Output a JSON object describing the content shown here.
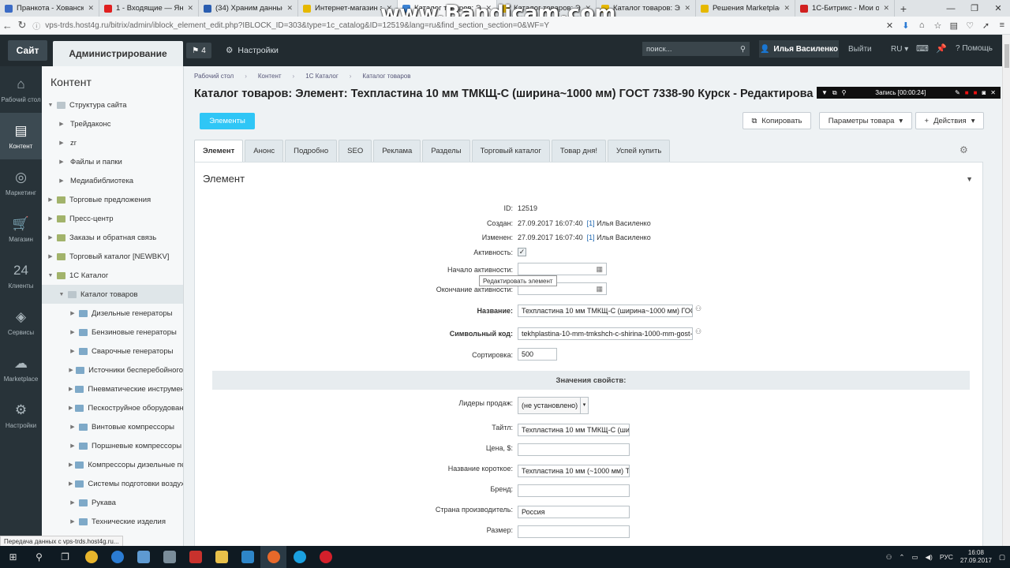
{
  "browser": {
    "tabs": [
      {
        "title": "Пранкота - Хованск",
        "color": "#3b6bc5",
        "active": false
      },
      {
        "title": "1 - Входящие — Яндекс",
        "color": "#e02020",
        "active": false
      },
      {
        "title": "(34) Храним данные в",
        "color": "#2a5db0",
        "active": false
      },
      {
        "title": "Интернет-магазин э",
        "color": "#e6b800",
        "active": false
      },
      {
        "title": "Каталог товаров: Элем",
        "color": "#3c83d4",
        "active": true
      },
      {
        "title": "Каталог товаров: Элем",
        "color": "#e6b800",
        "active": false
      },
      {
        "title": "Каталог товаров: Элем",
        "color": "#e6b800",
        "active": false
      },
      {
        "title": "Решения Marketplace",
        "color": "#e6b800",
        "active": false
      },
      {
        "title": "1С-Битрикс - Мои обр",
        "color": "#d12020",
        "active": false
      }
    ],
    "url": "vps-trds.host4g.ru/bitrix/admin/iblock_element_edit.php?IBLOCK_ID=303&type=1c_catalog&ID=12519&lang=ru&find_section_section=0&WF=Y",
    "url_info": "ⓘ"
  },
  "watermark": "www.Bandicam.com",
  "recorder": {
    "label": "Запись [00:00:24]"
  },
  "panel": {
    "site_label": "Сайт",
    "admin_label": "Администрирование",
    "notif_count": "4",
    "settings_label": "Настройки",
    "search_placeholder": "поиск...",
    "user_name": "Илья Василенко",
    "logout_label": "Выйти",
    "lang_label": "RU",
    "help_label": "Помощь"
  },
  "sidebar_icons": [
    {
      "label": "Рабочий стол",
      "icon": "home-icon",
      "active": false
    },
    {
      "label": "Контент",
      "icon": "document-icon",
      "active": true
    },
    {
      "label": "Маркетинг",
      "icon": "target-icon",
      "active": false
    },
    {
      "label": "Магазин",
      "icon": "cart-icon",
      "active": false
    },
    {
      "label": "Клиенты",
      "icon": "clients-icon",
      "active": false
    },
    {
      "label": "Сервисы",
      "icon": "layers-icon",
      "active": false
    },
    {
      "label": "Marketplace",
      "icon": "cloud-download-icon",
      "active": false
    },
    {
      "label": "Настройки",
      "icon": "gear-icon",
      "active": false
    }
  ],
  "tree": {
    "title": "Контент",
    "items": [
      {
        "label": "Структура сайта",
        "level": 1,
        "folder": "grey",
        "arrow": "▼"
      },
      {
        "label": "Трейдаконс",
        "level": 2,
        "folder": "none",
        "arrow": "▶"
      },
      {
        "label": "zr",
        "level": 2,
        "folder": "none",
        "arrow": "▶"
      },
      {
        "label": "Файлы и папки",
        "level": 2,
        "folder": "none",
        "arrow": "▶"
      },
      {
        "label": "Медиабиблиотека",
        "level": 2,
        "folder": "none",
        "arrow": "▶"
      },
      {
        "label": "Торговые предложения",
        "level": 1,
        "folder": "green",
        "arrow": "▶"
      },
      {
        "label": "Пресс-центр",
        "level": 1,
        "folder": "green",
        "arrow": "▶"
      },
      {
        "label": "Заказы и обратная связь",
        "level": 1,
        "folder": "green",
        "arrow": "▶"
      },
      {
        "label": "Торговый каталог [NEWBKV]",
        "level": 1,
        "folder": "green",
        "arrow": "▶"
      },
      {
        "label": "1С Каталог",
        "level": 1,
        "folder": "green",
        "arrow": "▼"
      },
      {
        "label": "Каталог товаров",
        "level": 2,
        "folder": "grey",
        "arrow": "▼",
        "active": true
      },
      {
        "label": "Дизельные генераторы",
        "level": 3,
        "folder": "blue",
        "arrow": "▶"
      },
      {
        "label": "Бензиновые генераторы",
        "level": 3,
        "folder": "blue",
        "arrow": "▶"
      },
      {
        "label": "Сварочные генераторы",
        "level": 3,
        "folder": "blue",
        "arrow": "▶"
      },
      {
        "label": "Источники бесперебойного",
        "level": 3,
        "folder": "blue",
        "arrow": "▶"
      },
      {
        "label": "Пневматические инструмен",
        "level": 3,
        "folder": "blue",
        "arrow": "▶"
      },
      {
        "label": "Пескоструйное оборудован",
        "level": 3,
        "folder": "blue",
        "arrow": "▶"
      },
      {
        "label": "Винтовые компрессоры",
        "level": 3,
        "folder": "blue",
        "arrow": "▶"
      },
      {
        "label": "Поршневые компрессоры",
        "level": 3,
        "folder": "blue",
        "arrow": "▶"
      },
      {
        "label": "Компрессоры дизельные пе",
        "level": 3,
        "folder": "blue",
        "arrow": "▶"
      },
      {
        "label": "Системы подготовки воздух",
        "level": 3,
        "folder": "blue",
        "arrow": "▶"
      },
      {
        "label": "Рукава",
        "level": 3,
        "folder": "blue",
        "arrow": "▶"
      },
      {
        "label": "Технические изделия",
        "level": 3,
        "folder": "blue",
        "arrow": "▶"
      }
    ]
  },
  "breadcrumbs": [
    "Рабочий стол",
    "Контент",
    "1С Каталог",
    "Каталог товаров"
  ],
  "page_title": "Каталог товаров: Элемент: Техпластина 10 мм ТМКЩ-С (ширина~1000 мм) ГОСТ 7338-90 Курск - Редактирова",
  "toolbar": {
    "elements_label": "Элементы",
    "copy_label": "Копировать",
    "params_label": "Параметры товара",
    "actions_label": "Действия"
  },
  "form_tabs": [
    "Элемент",
    "Анонс",
    "Подробно",
    "SEO",
    "Реклама",
    "Разделы",
    "Торговый каталог",
    "Товар дня!",
    "Успей купить"
  ],
  "section_title": "Элемент",
  "fields": {
    "id_label": "ID:",
    "id_value": "12519",
    "created_label": "Создан:",
    "created_value": "27.09.2017 16:07:40",
    "created_user_ref": "[1]",
    "created_user": "Илья Василенко",
    "modified_label": "Изменен:",
    "modified_value": "27.09.2017 16:07:40",
    "modified_user_ref": "[1]",
    "modified_user": "Илья Василенко",
    "active_label": "Активность:",
    "active_checked": "✓",
    "start_label": "Начало активности:",
    "end_label": "Окончание активности:",
    "name_label": "Название:",
    "name_value": "Техпластина 10 мм ТМКЩ-С (ширина~1000 мм) ГОСТ",
    "code_label": "Символьный код:",
    "code_value": "tekhplastina-10-mm-tmkshch-c-shirina-1000-mm-gost-7",
    "sort_label": "Сортировка:",
    "sort_value": "500"
  },
  "tooltip": "Редактировать элемент",
  "props": {
    "title": "Значения свойств:",
    "leaders_label": "Лидеры продаж:",
    "leaders_value": "(не установлено)",
    "title_label": "Тайтл:",
    "title_value": "Техпластина 10 мм ТМКЩ-С (шир",
    "price_label": "Цена, $:",
    "price_value": "",
    "short_label": "Название короткое:",
    "short_value": "Техпластина 10 мм (~1000 мм) ТМ",
    "brand_label": "Бренд:",
    "brand_value": "",
    "country_label": "Страна производитель:",
    "country_value": "Россия",
    "size_label": "Размер:",
    "size_value": ""
  },
  "status_text": "Передача данных с vps-trds.host4g.ru...",
  "taskbar": {
    "lang": "РУС",
    "time": "16:08",
    "date": "27.09.2017"
  }
}
